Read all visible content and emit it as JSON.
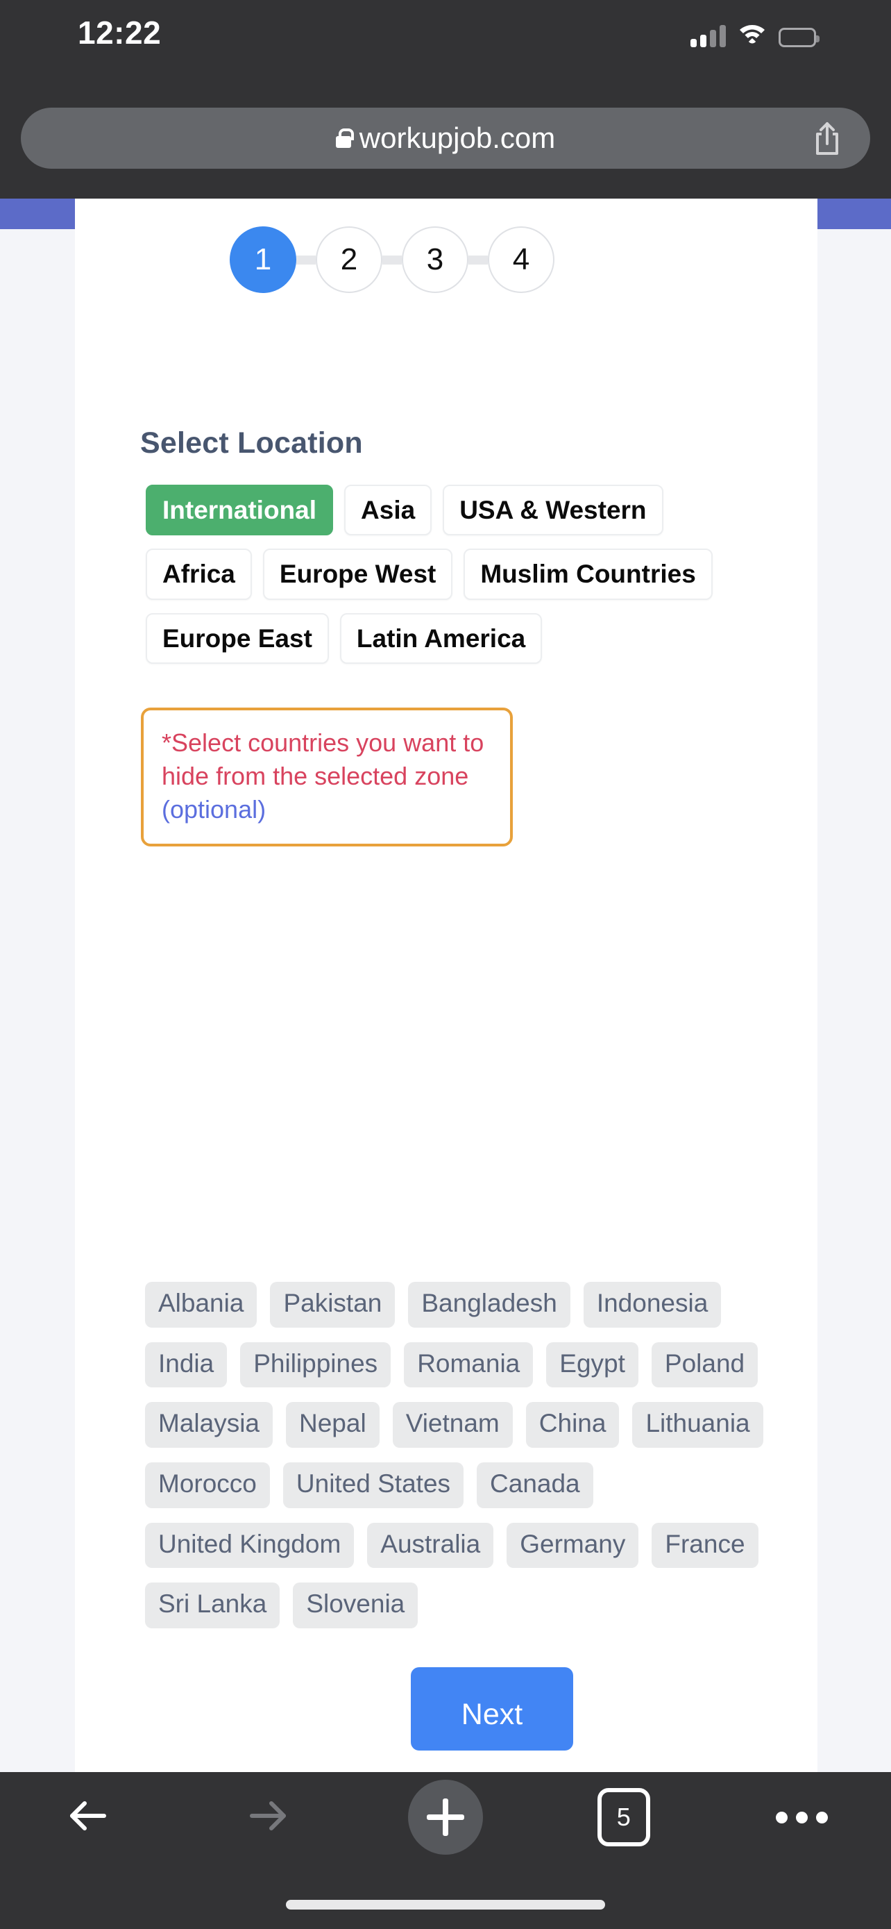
{
  "status_bar": {
    "time": "12:22",
    "cellular_icon": "cellular-signal-icon",
    "wifi_icon": "wifi-icon",
    "battery_icon": "battery-icon"
  },
  "browser": {
    "url": "workupjob.com",
    "lock_icon": "lock-icon",
    "share_icon": "share-icon",
    "toolbar": {
      "back_icon": "back-arrow-icon",
      "forward_icon": "forward-arrow-icon",
      "new_tab_icon": "plus-icon",
      "tab_count": "5",
      "more_icon": "ellipsis-icon"
    }
  },
  "page": {
    "accent_color": "#5c6bc8",
    "stepper": {
      "steps": [
        "1",
        "2",
        "3",
        "4"
      ],
      "active_index": 0,
      "active_color": "#3b88ef"
    },
    "section_title": "Select Location",
    "zones": [
      {
        "label": "International",
        "selected": true
      },
      {
        "label": "Asia",
        "selected": false
      },
      {
        "label": "USA & Western",
        "selected": false
      },
      {
        "label": "Africa",
        "selected": false
      },
      {
        "label": "Europe West",
        "selected": false
      },
      {
        "label": "Muslim Countries",
        "selected": false
      },
      {
        "label": "Europe East",
        "selected": false
      },
      {
        "label": "Latin America",
        "selected": false
      }
    ],
    "selected_zone_color": "#4caf6e",
    "warning": {
      "main_text": "*Select countries you want to hide from the selected zone ",
      "optional_text": "(optional)",
      "border_color": "#e8a13b",
      "text_color": "#d8435e",
      "optional_color": "#5b6ede"
    },
    "countries": [
      "Albania",
      "Pakistan",
      "Bangladesh",
      "Indonesia",
      "India",
      "Philippines",
      "Romania",
      "Egypt",
      "Poland",
      "Malaysia",
      "Nepal",
      "Vietnam",
      "China",
      "Lithuania",
      "Morocco",
      "United States",
      "Canada",
      "United Kingdom",
      "Australia",
      "Germany",
      "France",
      "Sri Lanka",
      "Slovenia"
    ],
    "next_button": {
      "label": "Next",
      "color": "#4285f4"
    }
  }
}
